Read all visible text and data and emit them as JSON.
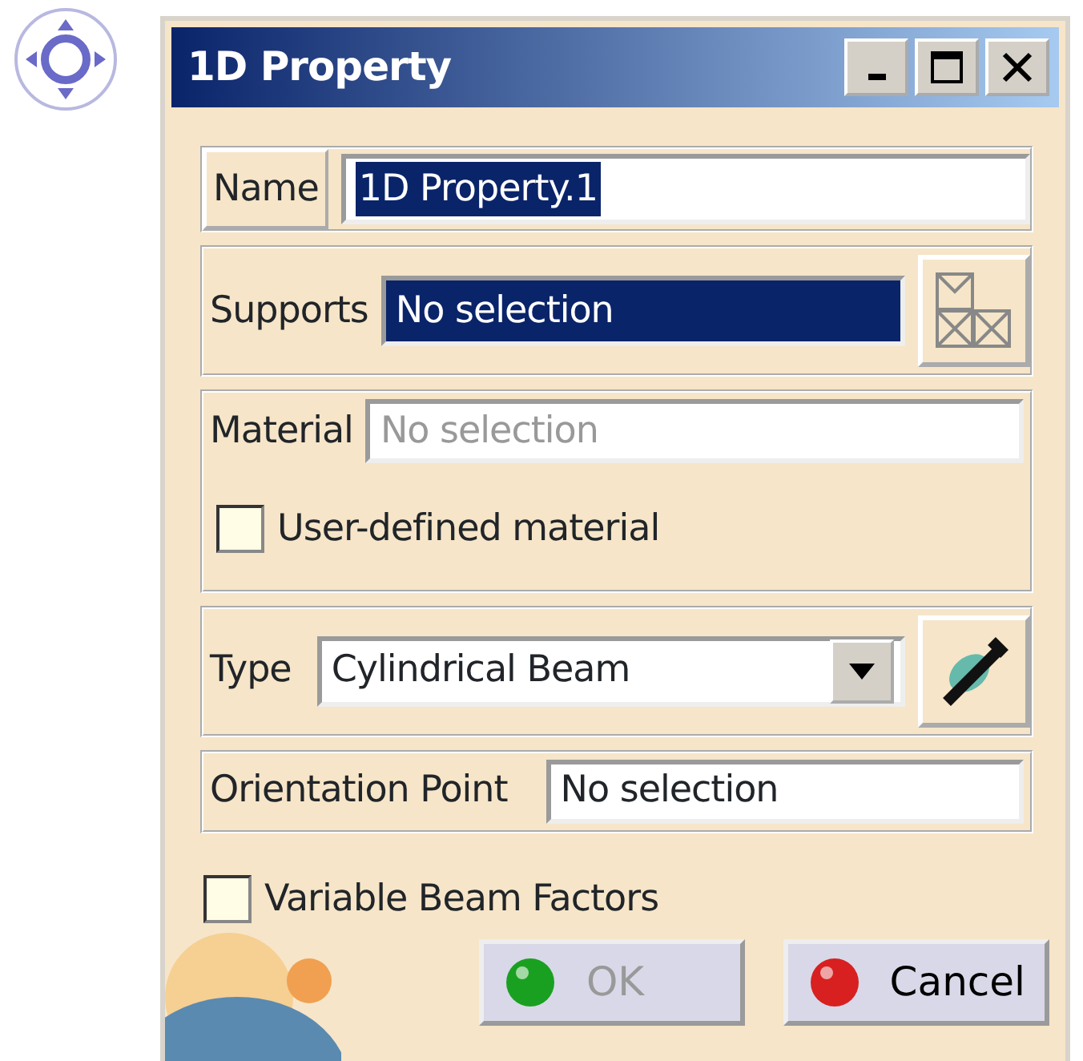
{
  "window": {
    "title": "1D Property"
  },
  "name": {
    "label": "Name",
    "value": "1D Property.1",
    "selected": true
  },
  "supports": {
    "label": "Supports",
    "value": "No selection",
    "selected": true
  },
  "material": {
    "label": "Material",
    "value": "No selection",
    "disabled": true,
    "checkbox": {
      "label": "User-defined material",
      "checked": false
    }
  },
  "type": {
    "label": "Type",
    "value": "Cylindrical Beam"
  },
  "orientation_point": {
    "label": "Orientation Point",
    "value": "No selection"
  },
  "variable_beam_factors": {
    "label": "Variable Beam Factors",
    "checked": false
  },
  "buttons": [
    {
      "kind": "ok",
      "label": "OK",
      "disabled": true
    },
    {
      "kind": "cancel",
      "label": "Cancel",
      "disabled": false
    }
  ]
}
